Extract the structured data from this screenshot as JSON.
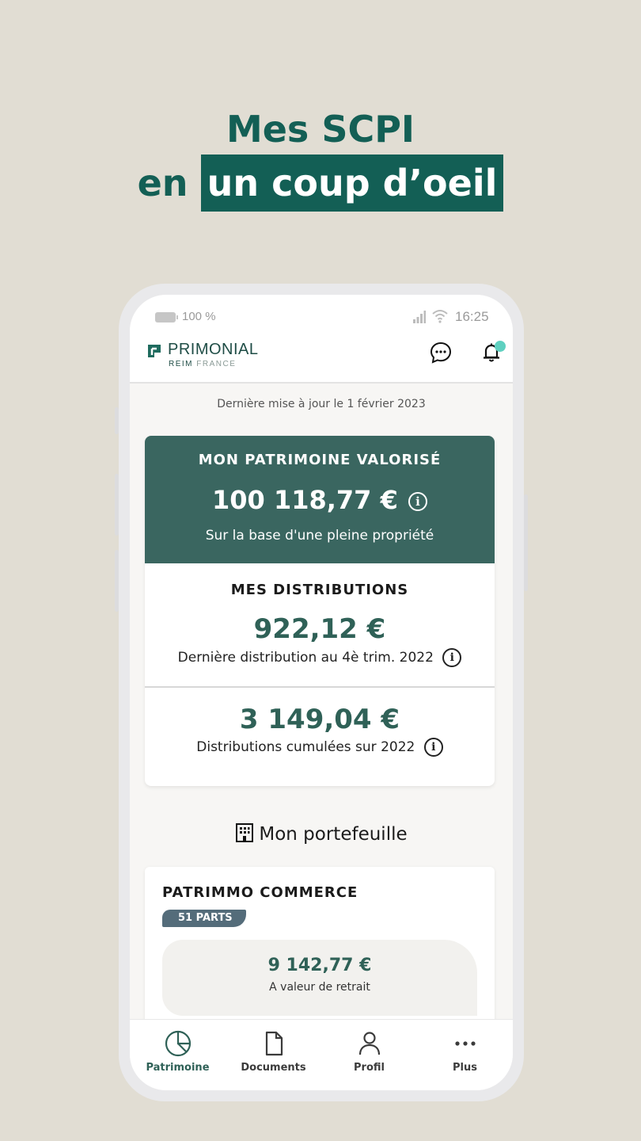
{
  "headline": {
    "line1": "Mes SCPI",
    "line2_prefix": "en",
    "line2_highlight": "un coup d’oeil"
  },
  "statusbar": {
    "battery": "100 %",
    "time": "16:25"
  },
  "appbar": {
    "brand": "PRIMONIAL",
    "brand_sub_1": "REIM",
    "brand_sub_2": "FRANCE"
  },
  "updated": "Dernière mise à jour le 1 février 2023",
  "patrimoine": {
    "title": "MON PATRIMOINE VALORISÉ",
    "amount": "100 118,77 €",
    "subtitle": "Sur la base d'une pleine propriété"
  },
  "distributions": {
    "title": "MES DISTRIBUTIONS",
    "last_amount": "922,12 €",
    "last_label": "Dernière distribution au 4è trim. 2022",
    "cumulative_amount": "3 149,04 €",
    "cumulative_label": "Distributions cumulées sur 2022"
  },
  "portfolio": {
    "title": "Mon portefeuille",
    "items": [
      {
        "name": "PATRIMMO COMMERCE",
        "parts": "51 PARTS",
        "value": "9 142,77 €",
        "value_label": "A valeur de retrait"
      }
    ]
  },
  "nav": {
    "items": [
      {
        "label": "Patrimoine",
        "icon": "pie-chart-icon",
        "active": true
      },
      {
        "label": "Documents",
        "icon": "document-icon",
        "active": false
      },
      {
        "label": "Profil",
        "icon": "user-icon",
        "active": false
      },
      {
        "label": "Plus",
        "icon": "more-icon",
        "active": false
      }
    ]
  },
  "colors": {
    "background": "#e1ddd3",
    "brand_green": "#135f55",
    "card_green": "#3a6660",
    "amount_green": "#2f6157",
    "badge": "#546c7a",
    "notification_dot": "#5fd0c0"
  }
}
